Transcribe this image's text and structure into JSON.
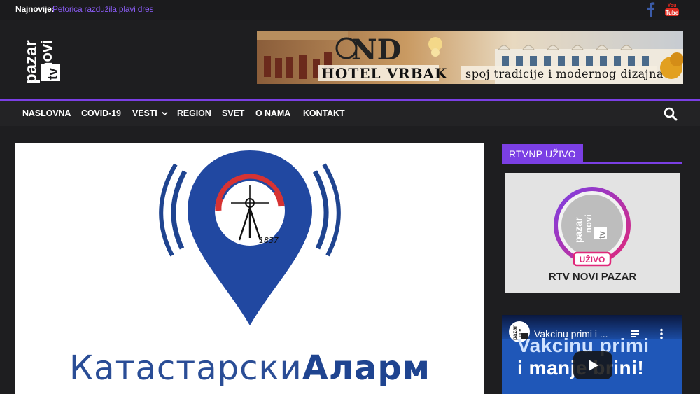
{
  "topbar": {
    "label": "Najnovije:",
    "latest_link": "Petorica razdužila plavi dres",
    "social": [
      "facebook-icon",
      "youtube-icon"
    ]
  },
  "logo": {
    "line1": "novi",
    "line2": "pazar",
    "line3": "tv"
  },
  "banner": {
    "brand": "HOTEL VRBAK",
    "monogram": "ND",
    "tagline": "spoj tradicije i modernog dizajna"
  },
  "nav": {
    "items": [
      "NASLOVNA",
      "COVID-19",
      "VESTI",
      "REGION",
      "SVET",
      "O NAMA",
      "KONTAKT"
    ],
    "dropdown_item": "VESTI",
    "search_icon": "search-icon"
  },
  "article": {
    "image_text_regular": "Катастарски",
    "image_text_bold": "Аларм",
    "pin_year": "1837"
  },
  "sidebar": {
    "widget_title": "RTVNP UŽIVO",
    "live_badge": "UŽIVO",
    "live_caption": "RTV NOVI PAZAR",
    "video": {
      "title": "Vakcinu primi i ...",
      "line1": "Vakcinu primi",
      "line2": "i manje brini!"
    }
  },
  "colors": {
    "accent": "#7b3fe4",
    "background": "#1e1e20",
    "link": "#8a5cf5",
    "alarm_blue": "#2a4d96",
    "alarm_red": "#d63333"
  }
}
